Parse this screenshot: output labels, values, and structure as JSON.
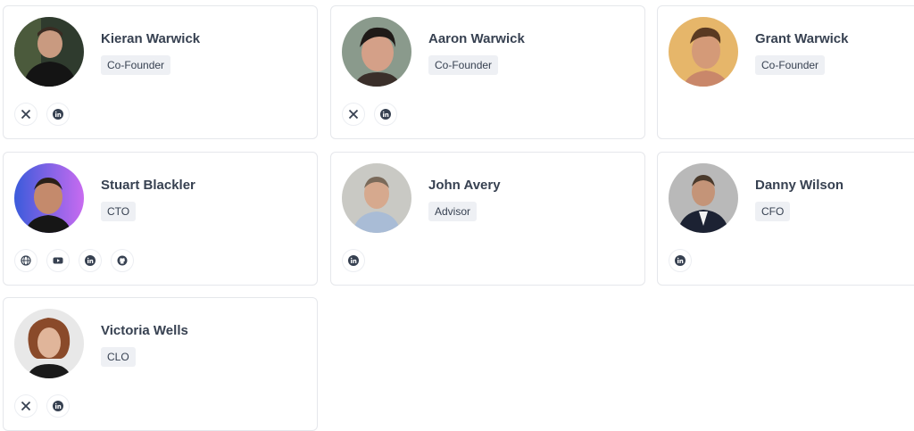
{
  "members": [
    {
      "name": "Kieran Warwick",
      "role": "Co-Founder",
      "socials": [
        "x-icon",
        "linkedin-icon"
      ]
    },
    {
      "name": "Aaron Warwick",
      "role": "Co-Founder",
      "socials": [
        "x-icon",
        "linkedin-icon"
      ]
    },
    {
      "name": "Grant Warwick",
      "role": "Co-Founder",
      "socials": []
    },
    {
      "name": "Stuart Blackler",
      "role": "CTO",
      "socials": [
        "globe-icon",
        "youtube-icon",
        "linkedin-icon",
        "github-icon"
      ]
    },
    {
      "name": "John Avery",
      "role": "Advisor",
      "socials": [
        "linkedin-icon"
      ]
    },
    {
      "name": "Danny Wilson",
      "role": "CFO",
      "socials": [
        "linkedin-icon"
      ]
    },
    {
      "name": "Victoria Wells",
      "role": "CLO",
      "socials": [
        "x-icon",
        "linkedin-icon"
      ]
    }
  ],
  "colors": {
    "icon": "#374151",
    "badge_bg": "#eef0f4",
    "border": "#e5e7eb"
  }
}
